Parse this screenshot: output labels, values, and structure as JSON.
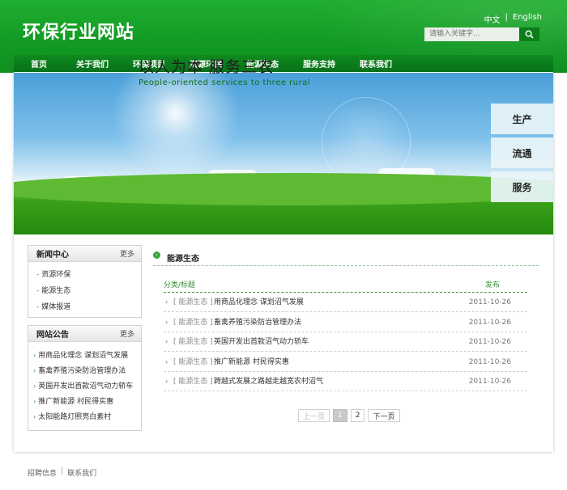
{
  "header": {
    "site_title": "环保行业网站",
    "lang_cn": "中文",
    "lang_sep": "|",
    "lang_en": "English",
    "search_placeholder": "请输入关键字..."
  },
  "nav": [
    "首页",
    "关于我们",
    "环保项目",
    "资源环保",
    "能源生态",
    "服务支持",
    "联系我们"
  ],
  "banner": {
    "title": "以人为本 服务三农",
    "subtitle": "People-oriented services to three rural",
    "side_tabs": [
      "生产",
      "流通",
      "服务"
    ]
  },
  "news_center": {
    "title": "新闻中心",
    "more": "更多",
    "items": [
      "资源环保",
      "能源生态",
      "媒体报道"
    ]
  },
  "notice": {
    "title": "网站公告",
    "more": "更多",
    "items": [
      "用商品化理念 谋划沼气发展",
      "畜禽养殖污染防治管理办法",
      "英国开发出首款沼气动力轿车",
      "推广新能源 村民得实惠",
      "太阳能路灯照亮白素村"
    ]
  },
  "main": {
    "section_title": "能源生态",
    "col_category": "分类/标题",
    "col_date": "发布",
    "rows": [
      {
        "category": "[ 能源生态 ]",
        "title": "用商品化理念 谋划沼气发展",
        "date": "2011-10-26"
      },
      {
        "category": "[ 能源生态 ]",
        "title": "畜禽养殖污染防治管理办法",
        "date": "2011-10-26"
      },
      {
        "category": "[ 能源生态 ]",
        "title": "英国开发出首款沼气动力轿车",
        "date": "2011-10-26"
      },
      {
        "category": "[ 能源生态 ]",
        "title": "推广新能源 村民得实惠",
        "date": "2011-10-26"
      },
      {
        "category": "[ 能源生态 ]",
        "title": "跨越式发展之路越走越宽农村沼气",
        "date": "2011-10-26"
      }
    ],
    "pager": {
      "prev": "上一页",
      "pages": [
        "1",
        "2"
      ],
      "next": "下一页"
    }
  },
  "footer": {
    "link1": "招聘信息",
    "sep": "|",
    "link2": "联系我们"
  }
}
